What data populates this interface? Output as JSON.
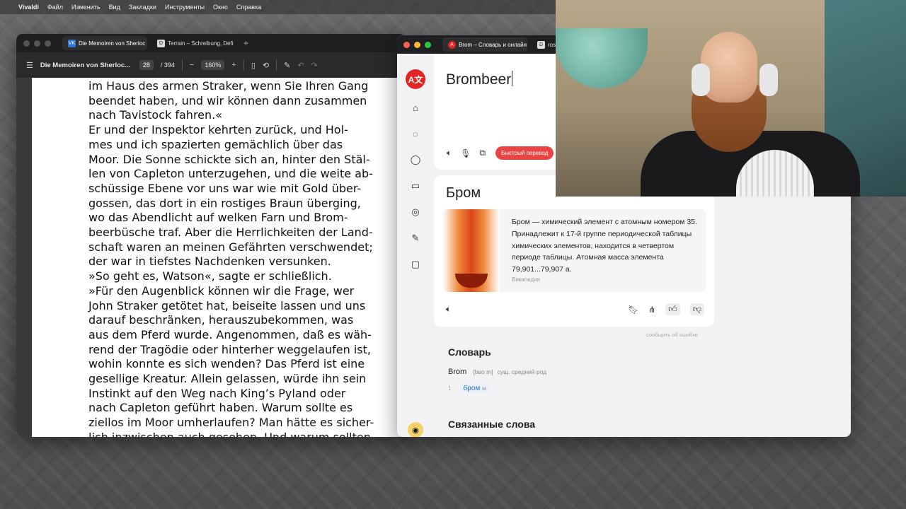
{
  "menubar": {
    "items": [
      "Vivaldi",
      "Файл",
      "Изменить",
      "Вид",
      "Закладки",
      "Инструменты",
      "Окно",
      "Справка"
    ]
  },
  "vivaldi": {
    "tabs": [
      {
        "label": "Die Memoiren von Sherloc",
        "icon": "vk-favicon"
      },
      {
        "label": "Terrain – Schreibung, Defi",
        "icon": "d-favicon"
      }
    ],
    "toolbar": {
      "doc_title": "Die Memoiren von Sherloc...",
      "page_current": "28",
      "page_total": "/ 394",
      "zoom": "160%"
    },
    "pdf_lines": [
      "im Haus des armen Straker, wenn Sie Ihren Gang",
      "beendet haben, und wir können dann zusammen",
      "nach Tavistock fahren.«",
      "   Er und der Inspektor kehrten zurück, und Hol-",
      "mes und ich spazierten gemächlich über das",
      "Moor. Die Sonne schickte sich an, hinter den Stäl-",
      "len von Capleton unterzugehen, und die weite ab-",
      "schüssige Ebene vor uns war wie mit Gold über-",
      "gossen, das dort in ein rostiges Braun überging,",
      "wo das Abendlicht auf welken Farn und Brom-",
      "beerbüsche traf. Aber die Herrlichkeiten der Land-",
      "schaft waren an meinen Gefährten verschwendet;",
      "der war in tiefstes Nachdenken versunken.",
      "   »So geht es, Watson«, sagte er schließlich.",
      "»Für den Augenblick können wir die Frage, wer",
      "John Straker getötet hat, beiseite lassen und uns",
      "darauf beschränken, herauszubekommen, was",
      "aus dem Pferd wurde. Angenommen, daß es wäh-",
      "rend der Tragödie oder hinterher weggelaufen ist,",
      "wohin konnte es sich wenden? Das Pferd ist eine",
      "gesellige Kreatur. Allein gelassen, würde ihn sein",
      "Instinkt auf den Weg nach King’s Pyland oder",
      "nach Capleton geführt haben. Warum sollte es",
      "ziellos im Moor umherlaufen? Man hätte es sicher-",
      "lich inzwischen auch gesehen. Und warum sollten"
    ]
  },
  "yandex": {
    "tabs": [
      {
        "label": "Brom – Словарь и онлайн",
        "icon": "yandex-translate-favicon"
      },
      {
        "label": "rostig –",
        "icon": "d-favicon"
      }
    ],
    "input_text": "Brombeer",
    "fast_translate": "Быстрый перевод",
    "result_word": "Бром",
    "wiki_text": "Бром — химический элемент с атомным номером 35. Принадлежит к 17-й группе периодической таблицы химических элементов, находится в четвертом периоде таблицы. Атомная масса элемента 79,901...79,907 а.",
    "wiki_source": "Википедия",
    "report_error": "сообщить об ошибке",
    "dictionary_title": "Словарь",
    "entry_word": "Brom",
    "entry_transcription": "[bʁoːm]",
    "entry_grammar": "сущ. средний род",
    "sense_number": "1",
    "sense_translation": "бром",
    "sense_gender": "м",
    "related_title": "Связанные слова"
  },
  "colors": {
    "yandex_red": "#e32525",
    "fast_button": "#e84444",
    "link_blue": "#2a6fc5"
  }
}
